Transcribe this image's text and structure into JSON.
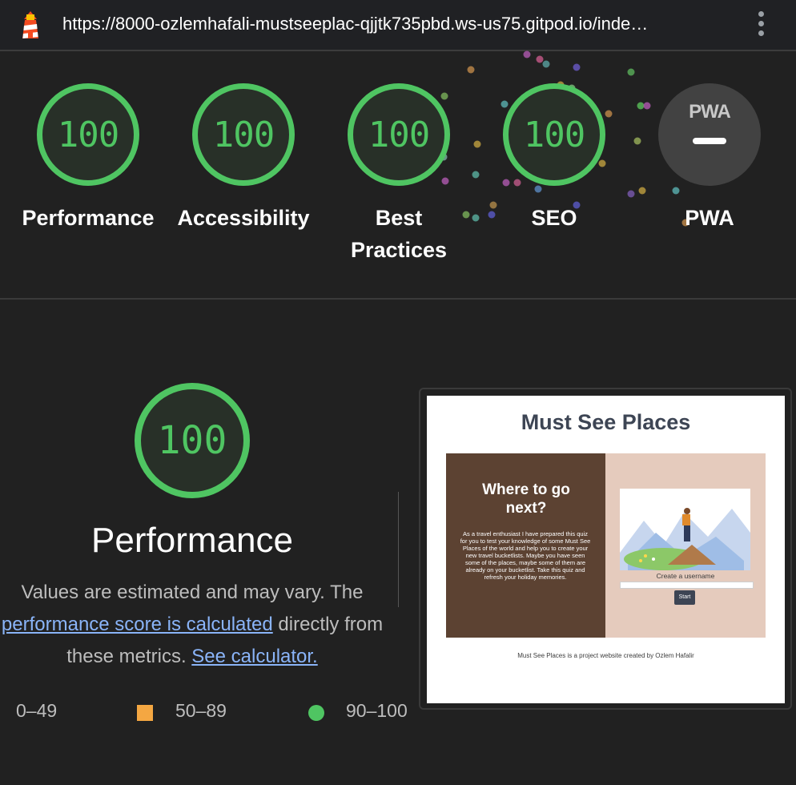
{
  "browser": {
    "url": "https://8000-ozlemhafali-mustseeplac-qjjtk735pbd.ws-us75.gitpod.io/inde…",
    "logo_icon": "lighthouse-icon",
    "menu_icon": "kebab-menu-icon"
  },
  "categories": [
    {
      "label": "Performance",
      "score": "100"
    },
    {
      "label": "Accessibility",
      "score": "100"
    },
    {
      "label": "Best Practices",
      "score": "100"
    },
    {
      "label": "SEO",
      "score": "100"
    },
    {
      "label": "PWA",
      "score": ""
    }
  ],
  "pwa_badge_text": "PWA",
  "performance_section": {
    "score": "100",
    "title": "Performance",
    "desc_part1": "Values are estimated and may vary. The ",
    "desc_link1": "performance score is calculated",
    "desc_part2": " directly from these metrics. ",
    "desc_link2": "See calculator."
  },
  "legend": {
    "fail": "0–49",
    "average": "50–89",
    "pass": "90–100"
  },
  "screenshot": {
    "title": "Must See Places",
    "heading": "Where to go next?",
    "paragraph": "As a travel enthusiast I have prepared this quiz for you to test your knowledge of some Must See Places of the world and help you to create your new travel bucketlists. Maybe you have seen some of the places, maybe some of them are already on your bucketlist. Take this quiz and refresh your holiday memories.",
    "username_label": "Create a username",
    "start_button": "Start",
    "footer": "Must See Places is a project website created by Ozlem Hafalir"
  },
  "colors": {
    "pass": "#4fc562",
    "average": "#f4a742",
    "background": "#212121",
    "link": "#8ab4f8"
  }
}
